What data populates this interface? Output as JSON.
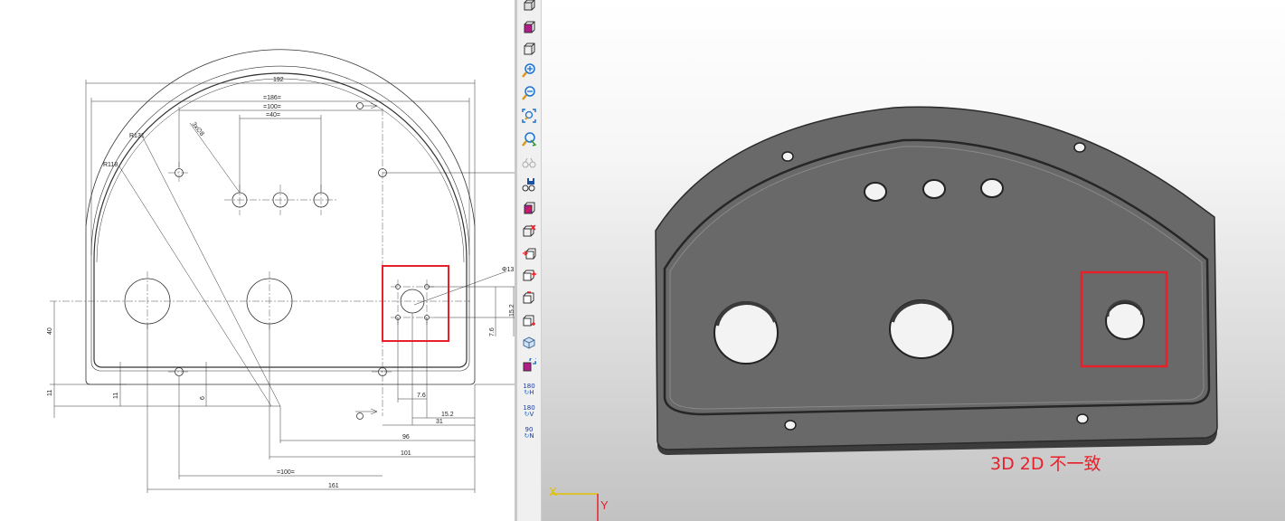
{
  "drawing": {
    "dims": {
      "overall_width": "192",
      "width_186": "=186=",
      "width_100_top": "=100=",
      "width_40": "=40=",
      "holes_3x": "3x∅8",
      "radius_131": "R131",
      "radius_118": "R118",
      "diameter_13": "Φ13",
      "h_40": "40",
      "h_11_left": "11",
      "h_11_inner": "11",
      "h_6": "6",
      "h_15_2_right": "15.2",
      "h_7_6_right": "7.6",
      "w_7_6": "7.6",
      "w_15_2": "15.2",
      "w_31": "31",
      "w_96": "96",
      "w_101": "101",
      "w_100_bottom": "=100=",
      "w_161": "161"
    },
    "highlight_color": "#e8202a"
  },
  "toolbar": {
    "buttons": [
      {
        "icon": "view-3d-icon"
      },
      {
        "icon": "box-front-icon"
      },
      {
        "icon": "box-wire-icon"
      },
      {
        "icon": "zoom-in-icon"
      },
      {
        "icon": "zoom-out-icon"
      },
      {
        "icon": "zoom-fit-icon"
      },
      {
        "icon": "zoom-window-icon"
      },
      {
        "icon": "glasses-icon"
      },
      {
        "icon": "save-view-icon"
      },
      {
        "icon": "section-icon"
      },
      {
        "icon": "delete-view-icon"
      },
      {
        "icon": "add-view-icon"
      },
      {
        "icon": "view-plus-icon"
      },
      {
        "icon": "view-minus-icon"
      },
      {
        "icon": "view-add-icon"
      },
      {
        "icon": "iso-cube-icon"
      },
      {
        "icon": "rotate-view-icon"
      }
    ],
    "rotate_h": {
      "value": "180",
      "axis": "H"
    },
    "rotate_v": {
      "value": "180",
      "axis": "V"
    },
    "rotate_n": {
      "value": "90",
      "axis": "N"
    }
  },
  "viewport": {
    "annotation": "3D 2D 不一致",
    "triad": {
      "x_label": "X",
      "y_label": "Y"
    },
    "highlight_color": "#e8202a",
    "part_color": "#696969"
  }
}
